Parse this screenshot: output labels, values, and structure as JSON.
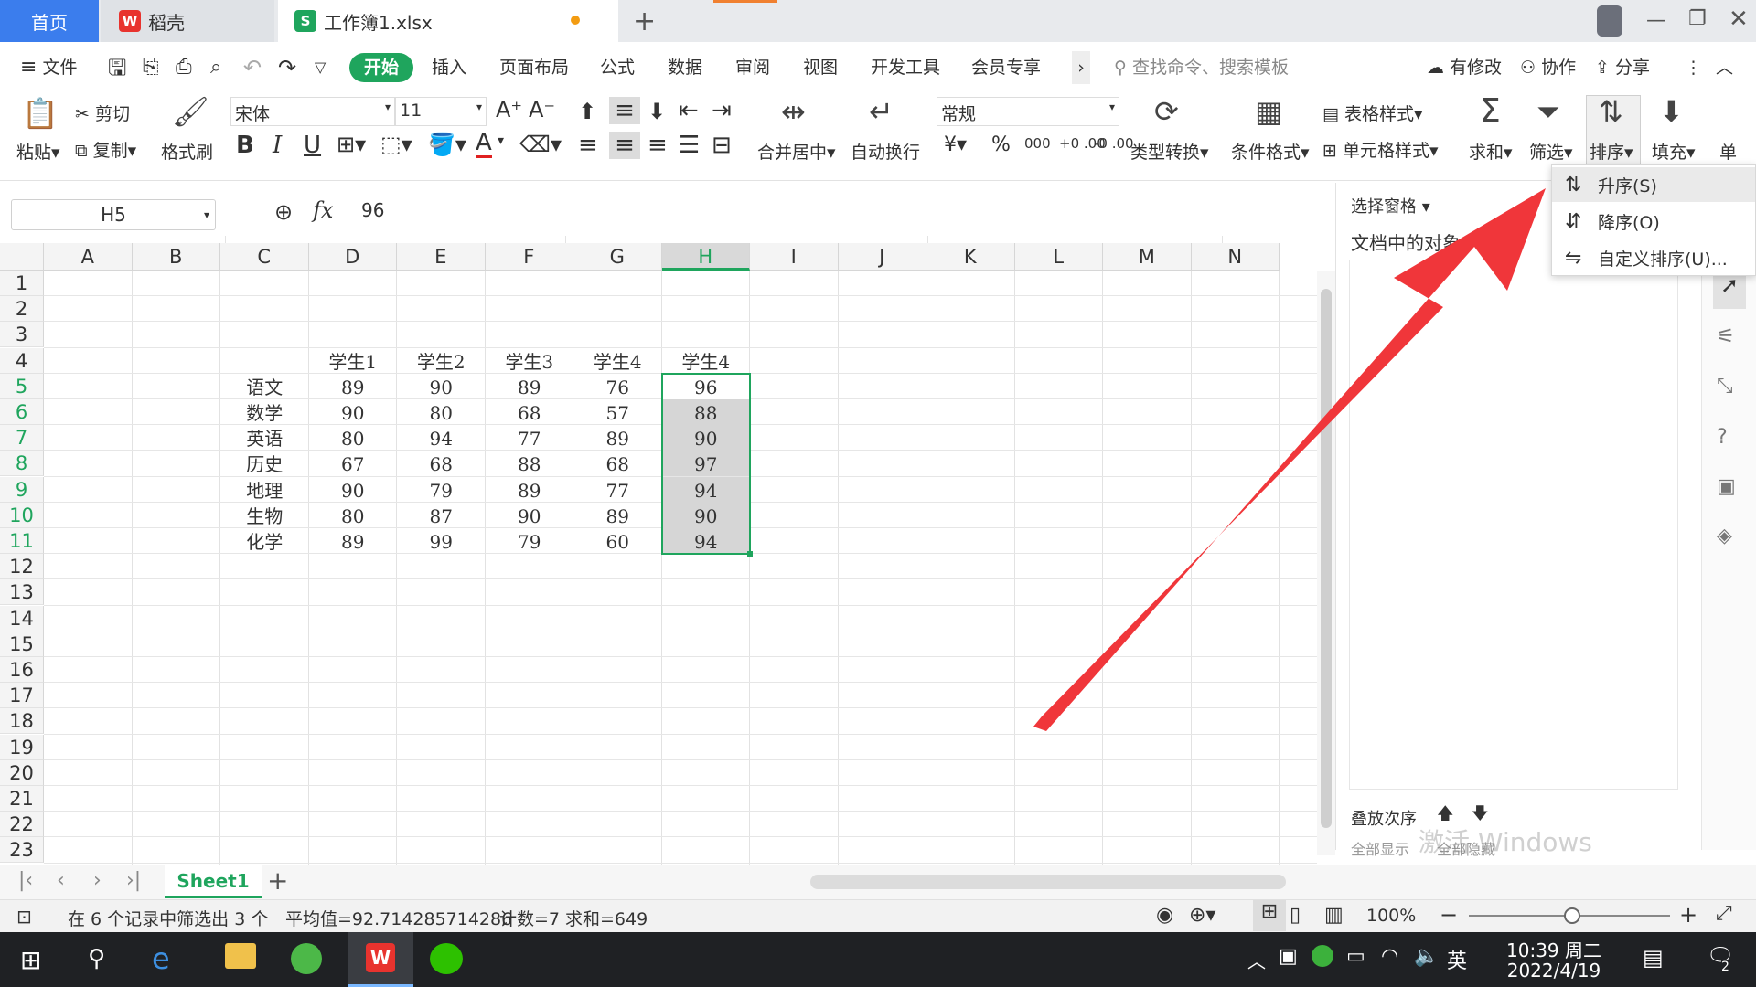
{
  "tabs": {
    "home": "首页",
    "daoke": "稻壳",
    "file": "工作簿1.xlsx",
    "new_tab": "+"
  },
  "menu": {
    "file": "文件",
    "items": [
      "开始",
      "插入",
      "页面布局",
      "公式",
      "数据",
      "审阅",
      "视图",
      "开发工具",
      "会员专享"
    ],
    "active": "开始",
    "search": "查找命令、搜索模板",
    "modified": "有修改",
    "collab": "协作",
    "share": "分享",
    "more": "›"
  },
  "ribbon": {
    "paste": "粘贴",
    "cut": "剪切",
    "copy": "复制",
    "format_painter": "格式刷",
    "font_name": "宋体",
    "font_size": "11",
    "bold": "B",
    "italic": "I",
    "underline": "U",
    "merge": "合并居中",
    "wrap": "自动换行",
    "number_format": "常规",
    "currency": "¥",
    "percent": "%",
    "thousands": "000",
    "dec_inc": "+0 .00",
    "dec_dec": "-0 .00",
    "type_convert": "类型转换",
    "cond_format": "条件格式",
    "table_style": "表格样式",
    "cell_style": "单元格样式",
    "sum": "求和",
    "filter": "筛选",
    "sort": "排序",
    "fill": "填充",
    "single": "单"
  },
  "formula": {
    "cell_ref": "H5",
    "fx": "fx",
    "value": "96"
  },
  "grid": {
    "columns": [
      "A",
      "B",
      "C",
      "D",
      "E",
      "F",
      "G",
      "H",
      "I",
      "J",
      "K",
      "L",
      "M",
      "N"
    ],
    "rows": [
      "1",
      "2",
      "3",
      "4",
      "5",
      "6",
      "7",
      "8",
      "9",
      "10",
      "11",
      "12",
      "13",
      "14",
      "15",
      "16",
      "17",
      "18",
      "19",
      "20",
      "21",
      "22",
      "23"
    ],
    "headers": [
      "学生1",
      "学生2",
      "学生3",
      "学生4",
      "学生4"
    ],
    "subjects": [
      "语文",
      "数学",
      "英语",
      "历史",
      "地理",
      "生物",
      "化学"
    ],
    "scores": [
      [
        "89",
        "90",
        "89",
        "76",
        "96"
      ],
      [
        "90",
        "80",
        "68",
        "57",
        "88"
      ],
      [
        "80",
        "94",
        "77",
        "89",
        "90"
      ],
      [
        "67",
        "68",
        "88",
        "68",
        "97"
      ],
      [
        "90",
        "79",
        "89",
        "77",
        "94"
      ],
      [
        "80",
        "87",
        "90",
        "89",
        "90"
      ],
      [
        "89",
        "99",
        "79",
        "60",
        "94"
      ]
    ]
  },
  "side": {
    "select_pane": "选择窗格",
    "doc_objects": "文档中的对象",
    "stack_order": "叠放次序",
    "show_all": "全部显示",
    "hide_all": "全部隐藏",
    "watermark": "激活 Windows"
  },
  "dropdown": {
    "ascending": "升序(S)",
    "descending": "降序(O)",
    "custom": "自定义排序(U)..."
  },
  "sheet": {
    "name": "Sheet1",
    "add": "+"
  },
  "status": {
    "filter_info": "在 6 个记录中筛选出 3 个",
    "average": "平均值=92.714285714286",
    "count": "计数=7",
    "sum": "求和=649",
    "zoom": "100%"
  },
  "taskbar": {
    "time": "10:39 周二",
    "date": "2022/4/19",
    "ime": "英",
    "notif": "2"
  },
  "colors": {
    "accent": "#1fa55d",
    "selection": "#d6d6d6",
    "arrow": "#f0363a",
    "tab_home": "#3b7ded"
  }
}
